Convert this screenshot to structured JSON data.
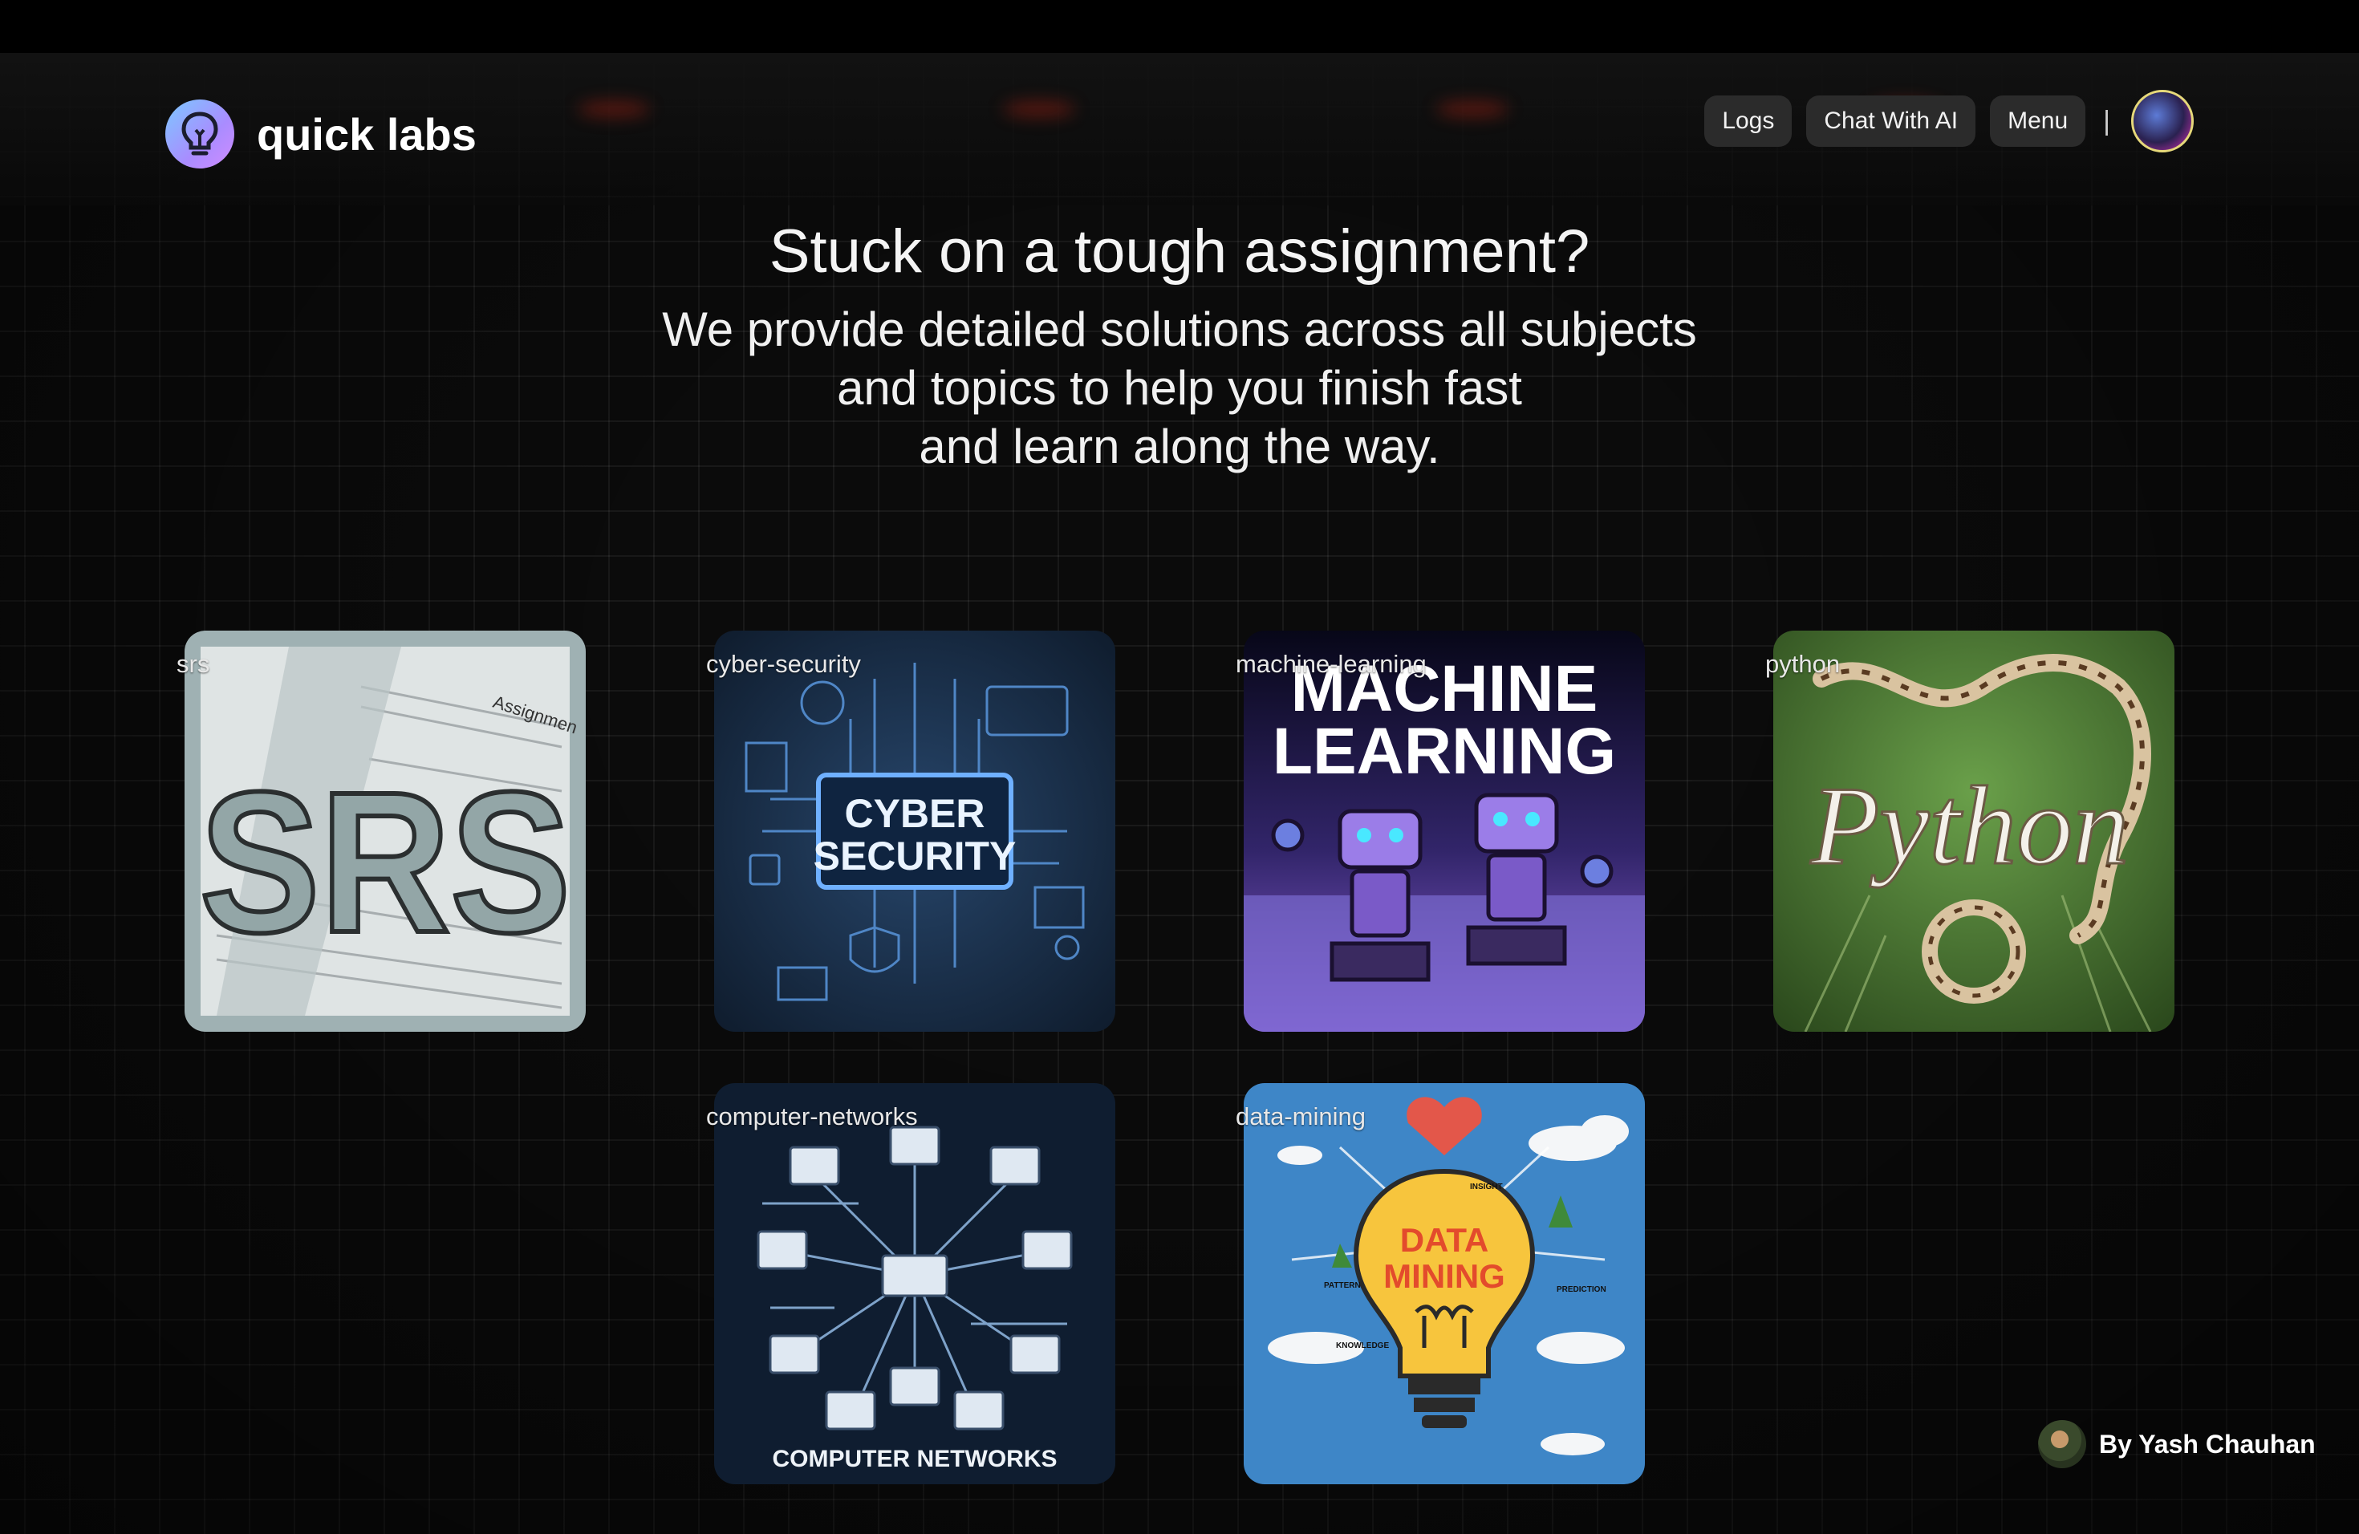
{
  "app": {
    "name": "quick labs"
  },
  "nav": {
    "logs": "Logs",
    "chat": "Chat With AI",
    "menu": "Menu",
    "divider": "|"
  },
  "hero": {
    "title": "Stuck on a tough assignment?",
    "line1": "We provide detailed solutions across all subjects",
    "line2": "and topics to help you finish fast",
    "line3": "and learn along the way."
  },
  "cards": [
    {
      "label": "srs",
      "art_text": "SRS",
      "corner_text": "Assignmen"
    },
    {
      "label": "cyber-security",
      "art_line1": "CYBER",
      "art_line2": "SECURITY"
    },
    {
      "label": "machine-learning",
      "art_line1": "MACHINE",
      "art_line2": "LEARNING"
    },
    {
      "label": "python",
      "art_text": "Python"
    },
    {
      "label": "computer-networks",
      "art_text": "COMPUTER NETWORKS"
    },
    {
      "label": "data-mining",
      "art_line1": "DATA",
      "art_line2": "MINING",
      "tags": [
        "INSIGHT",
        "PATTERN",
        "PREDICTION",
        "KNOWLEDGE"
      ]
    }
  ],
  "footer": {
    "credit": "By Yash Chauhan"
  },
  "colors": {
    "accent": "#8ab4ff",
    "nav_button_bg": "#2b2b2b",
    "background": "#0b0b0b"
  }
}
